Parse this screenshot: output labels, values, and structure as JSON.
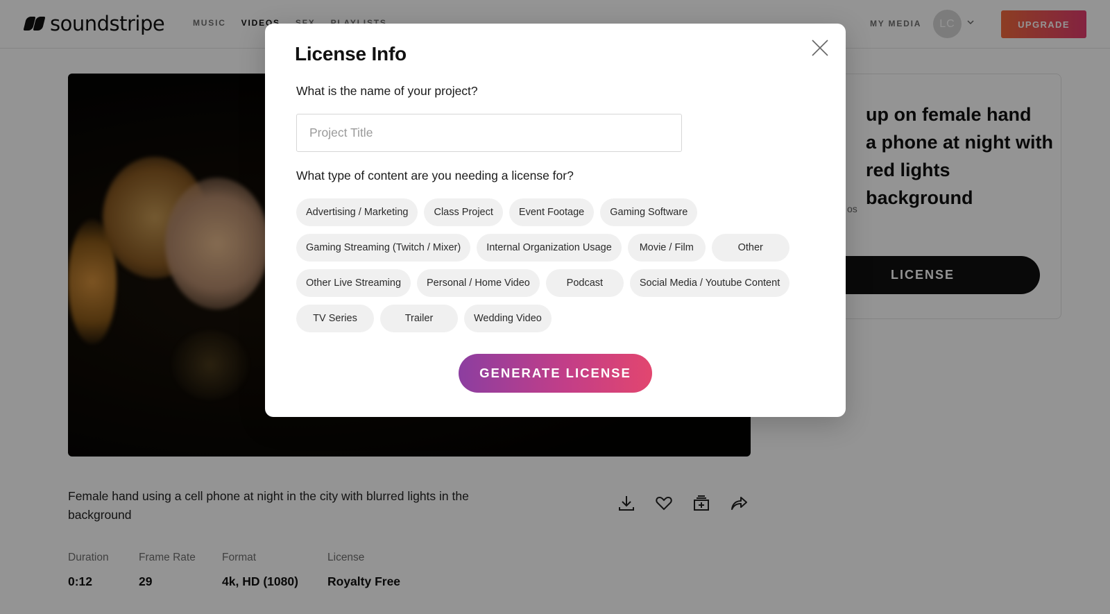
{
  "header": {
    "logo_text": "soundstripe",
    "nav": [
      {
        "label": "MUSIC",
        "active": false
      },
      {
        "label": "VIDEOS",
        "active": true
      },
      {
        "label": "SFX",
        "active": false
      },
      {
        "label": "PLAYLISTS",
        "active": false
      }
    ],
    "my_media": "MY MEDIA",
    "avatar_initials": "LC",
    "upgrade_label": "UPGRADE"
  },
  "video": {
    "description": "Female hand using a cell phone at night in the city with blurred lights in the background",
    "meta": [
      {
        "label": "Duration",
        "value": "0:12"
      },
      {
        "label": "Frame Rate",
        "value": "29"
      },
      {
        "label": "Format",
        "value": "4k, HD (1080)"
      },
      {
        "label": "License",
        "value": "Royalty Free"
      }
    ]
  },
  "side_card": {
    "title_visible": "up on female hand\na phone at night with\nred lights background",
    "sub_visible": "os",
    "license_label": "LICENSE"
  },
  "modal": {
    "title": "License Info",
    "question_name": "What is the name of your project?",
    "project_placeholder": "Project Title",
    "project_value": "",
    "question_type": "What type of content are you needing a license for?",
    "content_types": [
      "Advertising / Marketing",
      "Class Project",
      "Event Footage",
      "Gaming Software",
      "Gaming Streaming (Twitch / Mixer)",
      "Internal Organization Usage",
      "Movie / Film",
      "Other",
      "Other Live Streaming",
      "Personal / Home Video",
      "Podcast",
      "Social Media / Youtube Content",
      "TV Series",
      "Trailer",
      "Wedding Video"
    ],
    "generate_label": "GENERATE LICENSE"
  },
  "colors": {
    "upgrade_gradient": [
      "#f26a3d",
      "#e23c6f"
    ],
    "generate_gradient": [
      "#8c3ea0",
      "#e2466f"
    ],
    "chip_bg": "#f0f0f0"
  }
}
